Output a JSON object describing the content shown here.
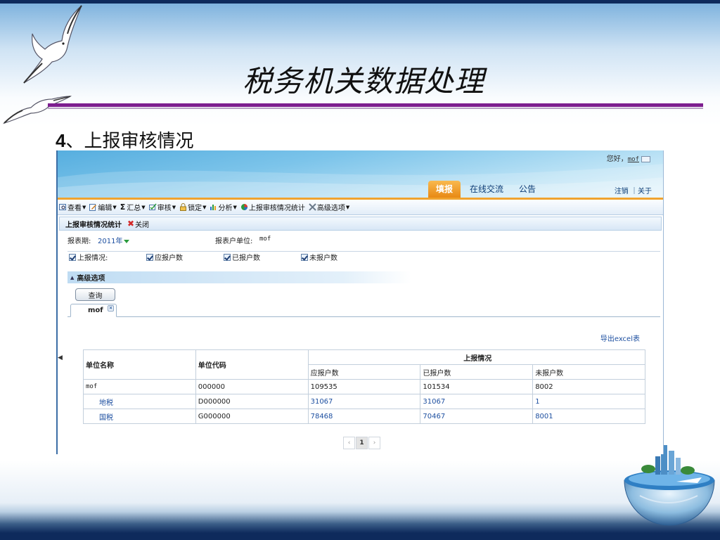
{
  "slide": {
    "title": "税务机关数据处理",
    "section_number": "4",
    "section_text": "、上报审核情况"
  },
  "header": {
    "greeting": "您好，",
    "username": "mof",
    "nav_tabs": [
      {
        "label": "填报",
        "active": true
      },
      {
        "label": "在线交流",
        "active": false
      },
      {
        "label": "公告",
        "active": false
      }
    ],
    "logout_label": "注销",
    "about_label": "｜关于"
  },
  "toolbar": [
    {
      "label": "查看",
      "icon": "view-icon",
      "dropdown": true
    },
    {
      "label": "编辑",
      "icon": "edit-icon",
      "dropdown": true
    },
    {
      "label": "汇总",
      "icon": "sum-icon",
      "glyph": "Σ",
      "dropdown": true
    },
    {
      "label": "审核",
      "icon": "audit-icon",
      "dropdown": true
    },
    {
      "label": "锁定",
      "icon": "lock-icon",
      "dropdown": true
    },
    {
      "label": "分析",
      "icon": "chart-icon",
      "dropdown": true
    },
    {
      "label": "上报审核情况统计",
      "icon": "pie-icon",
      "dropdown": false
    },
    {
      "label": "高级选项",
      "icon": "tools-icon",
      "dropdown": true
    }
  ],
  "panel": {
    "title": "上报审核情况统计",
    "close_label": "关闭"
  },
  "filters": {
    "period_label": "报表期:",
    "period_value": "2011年",
    "unit_label": "报表户单位:",
    "unit_value": "mof"
  },
  "checkboxes": {
    "group_label": "上报情况:",
    "items": [
      {
        "label": "应报户数",
        "checked": true
      },
      {
        "label": "已报户数",
        "checked": true
      },
      {
        "label": "未报户数",
        "checked": true
      }
    ]
  },
  "advanced_label": "高级选项",
  "query_button": "查询",
  "result_tab": "mof",
  "result_tab_close": "×",
  "export_label": "导出excel表",
  "table": {
    "headers": {
      "name": "单位名称",
      "code": "单位代码",
      "group": "上报情况",
      "sub": [
        "应报户数",
        "已报户数",
        "未报户数"
      ]
    },
    "rows": [
      {
        "name": "mof",
        "code": "000000",
        "values": [
          "109535",
          "101534",
          "8002"
        ],
        "child": false
      },
      {
        "name": "地税",
        "code": "D000000",
        "values": [
          "31067",
          "31067",
          "1"
        ],
        "child": true
      },
      {
        "name": "国税",
        "code": "G000000",
        "values": [
          "78468",
          "70467",
          "8001"
        ],
        "child": true
      }
    ]
  },
  "pager": {
    "prev": "‹",
    "current": "1",
    "next": "›"
  },
  "colors": {
    "accent_orange": "#e88914",
    "link_blue": "#1d4fa0",
    "title_rule_purple": "#7d1e8f"
  }
}
